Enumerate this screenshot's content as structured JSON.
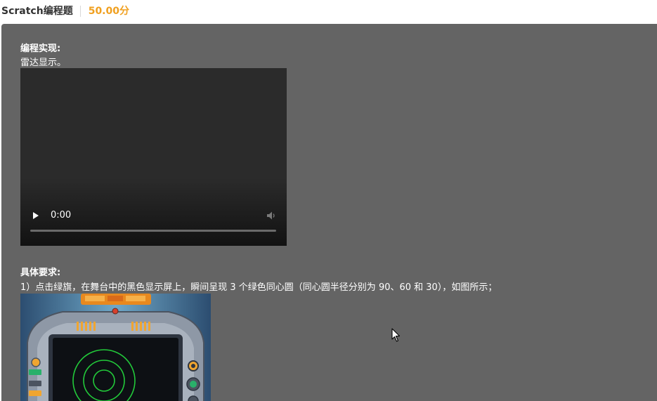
{
  "header": {
    "question_type": "Scratch编程题",
    "score": "50.00分"
  },
  "task": {
    "heading": "编程实现:",
    "description": "雷达显示。"
  },
  "video": {
    "time": "0:00",
    "progress_fraction": 0
  },
  "requirements": {
    "heading": "具体要求:",
    "item1": "1）点击绿旗，在舞台中的黑色显示屏上，瞬间呈现 3 个绿色同心圆（同心圆半径分别为 90、60 和 30），如图所示；"
  },
  "colors": {
    "score": "#f0a020",
    "panel_background": "#646464",
    "radar_green": "#22c93a"
  },
  "icons": {
    "play": "play-icon",
    "volume": "volume-icon",
    "cursor": "mouse-cursor-icon"
  }
}
